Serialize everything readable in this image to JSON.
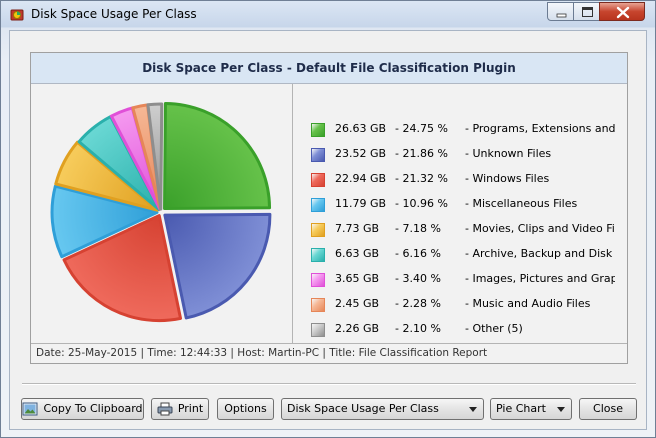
{
  "window": {
    "title": "Disk Space Usage Per Class"
  },
  "panel": {
    "heading": "Disk Space Per Class - Default File Classification Plugin",
    "status": "Date: 25-May-2015 | Time: 12:44:33 | Host: Martin-PC | Title: File Classification Report"
  },
  "chart_data": {
    "type": "pie",
    "title": "",
    "slices": [
      {
        "size": "26.63 GB",
        "percent_label": "24.75 %",
        "name": "Programs, Extensions and S...",
        "value": 24.75,
        "fill": "#66c24a",
        "edge": "#3aa02a"
      },
      {
        "size": "23.52 GB",
        "percent_label": "21.86 %",
        "name": "Unknown Files",
        "value": 21.86,
        "fill": "#7f8fd6",
        "edge": "#4a5ab0"
      },
      {
        "size": "22.94 GB",
        "percent_label": "21.32 %",
        "name": "Windows Files",
        "value": 21.32,
        "fill": "#ef6a5c",
        "edge": "#d64232"
      },
      {
        "size": "11.79 GB",
        "percent_label": "10.96 %",
        "name": "Miscellaneous Files",
        "value": 10.96,
        "fill": "#67c8f0",
        "edge": "#2f9fd8"
      },
      {
        "size": "7.73 GB",
        "percent_label": "7.18 %",
        "name": "Movies, Clips and Video Files",
        "value": 7.18,
        "fill": "#f7cc5c",
        "edge": "#e0a020"
      },
      {
        "size": "6.63 GB",
        "percent_label": "6.16 %",
        "name": "Archive, Backup and Disk I...",
        "value": 6.16,
        "fill": "#6ad8d4",
        "edge": "#2ab0ac"
      },
      {
        "size": "3.65 GB",
        "percent_label": "3.40 %",
        "name": "Images, Pictures and Graph...",
        "value": 3.4,
        "fill": "#f59af0",
        "edge": "#e050d8"
      },
      {
        "size": "2.45 GB",
        "percent_label": "2.28 %",
        "name": "Music and Audio Files",
        "value": 2.28,
        "fill": "#f6b896",
        "edge": "#e68658"
      },
      {
        "size": "2.26 GB",
        "percent_label": "2.10 %",
        "name": "Other (5)",
        "value": 2.1,
        "fill": "#cfcfcf",
        "edge": "#8e8e8e"
      }
    ],
    "legend_position": "right",
    "separator": "-"
  },
  "buttons": {
    "copy": "Copy To Clipboard",
    "print": "Print",
    "options": "Options",
    "close": "Close"
  },
  "combos": {
    "report": "Disk Space Usage Per Class",
    "chart_type": "Pie Chart"
  }
}
